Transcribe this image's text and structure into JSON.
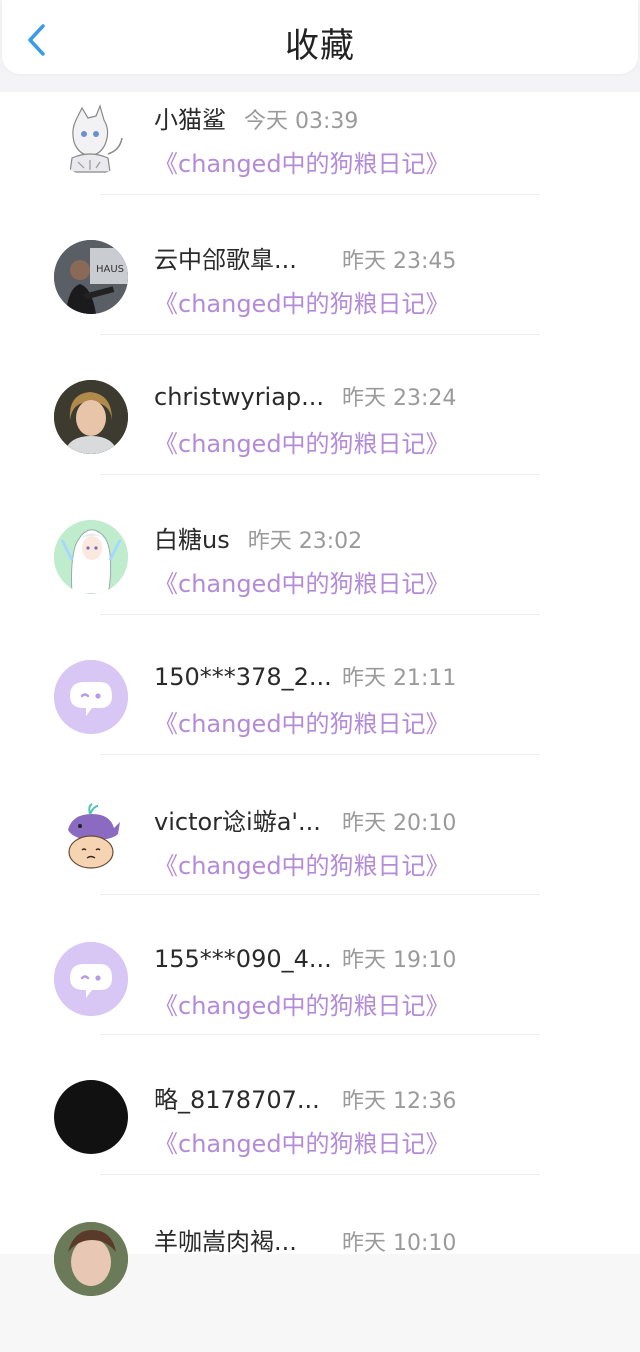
{
  "header": {
    "title": "收藏",
    "back_icon": "chevron-left-icon",
    "accent_color": "#3a9be8"
  },
  "items": [
    {
      "name": "小猫鲨",
      "time": "今天 03:39",
      "link": "《changed中的狗粮日记》",
      "avatar": "anime-cat-shark-avatar"
    },
    {
      "name": "云中郃歌臯...",
      "time": "昨天 23:45",
      "link": "《changed中的狗粮日记》",
      "avatar": "photo-avatar"
    },
    {
      "name": "christwyriap...",
      "time": "昨天 23:24",
      "link": "《changed中的狗粮日记》",
      "avatar": "photo-avatar"
    },
    {
      "name": "白糖us",
      "time": "昨天 23:02",
      "link": "《changed中的狗粮日记》",
      "avatar": "anime-avatar"
    },
    {
      "name": "150***378_2...",
      "time": "昨天 21:11",
      "link": "《changed中的狗粮日记》",
      "avatar": "default-chat-avatar"
    },
    {
      "name": "victor谂i蝣a'...",
      "time": "昨天 20:10",
      "link": "《changed中的狗粮日记》",
      "avatar": "whale-cartoon-avatar"
    },
    {
      "name": "155***090_4...",
      "time": "昨天 19:10",
      "link": "《changed中的狗粮日记》",
      "avatar": "default-chat-avatar"
    },
    {
      "name": "略_8178707...",
      "time": "昨天 12:36",
      "link": "《changed中的狗粮日记》",
      "avatar": "black-avatar"
    },
    {
      "name": "羊咖嵩肉褐...",
      "time": "昨天 10:10",
      "link": "",
      "avatar": "photo-avatar"
    }
  ],
  "colors": {
    "link": "#b38bd8",
    "default_avatar": "#d8c7f5"
  }
}
